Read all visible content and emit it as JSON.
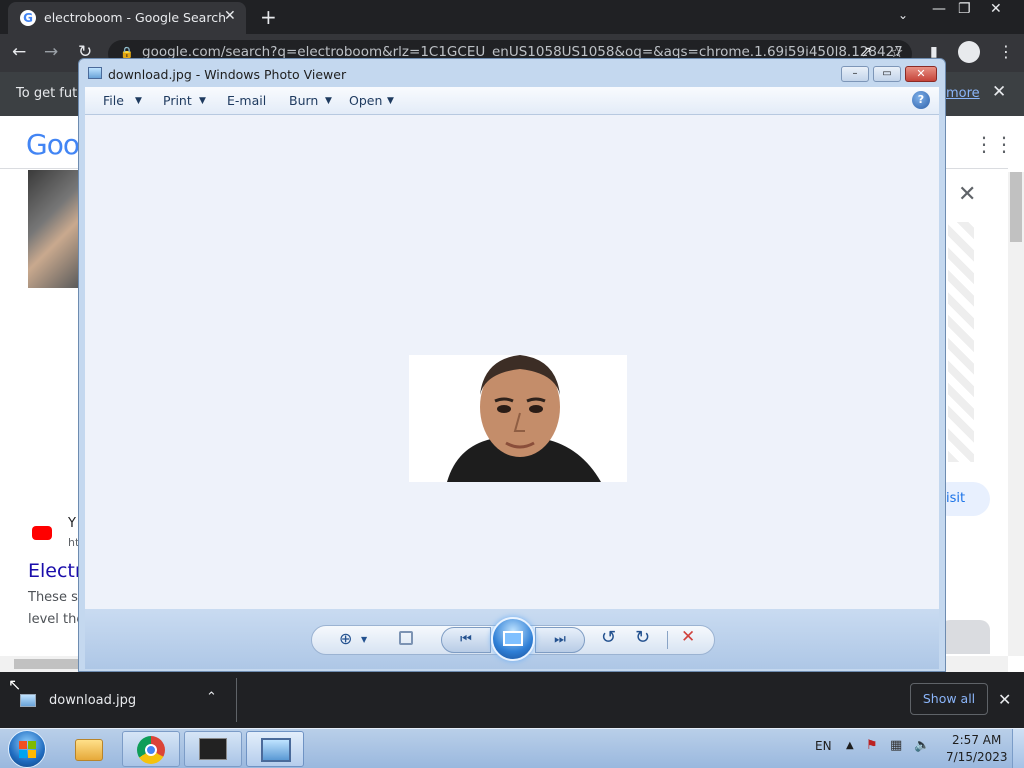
{
  "browser": {
    "tab_title": "electroboom - Google Search",
    "url": "google.com/search?q=electroboom&rlz=1C1GCEU_enUS1058US1058&oq=&aqs=chrome.1.69i59i450l8.128427",
    "infobar_text": "To get futu",
    "infobar_link": "more",
    "page_visible_result_title": "Electr",
    "page_snippet_line1": "These s",
    "page_snippet_line2": "level the",
    "visit_button": "isit",
    "youtube_letter": "Y",
    "youtube_sub": "ht",
    "google_logo_partial": "Goo"
  },
  "photo_viewer": {
    "title": "download.jpg - Windows Photo Viewer",
    "menu": {
      "file": "File",
      "print": "Print",
      "email": "E-mail",
      "burn": "Burn",
      "open": "Open"
    },
    "help_label": "?"
  },
  "downloads": {
    "file_name": "download.jpg",
    "show_all": "Show all"
  },
  "taskbar": {
    "language": "EN",
    "time": "2:57 AM",
    "date": "7/15/2023"
  },
  "colors": {
    "accent": "#1a73e8",
    "viewer_bg": "#eef2fa",
    "close_red": "#d0413c"
  }
}
